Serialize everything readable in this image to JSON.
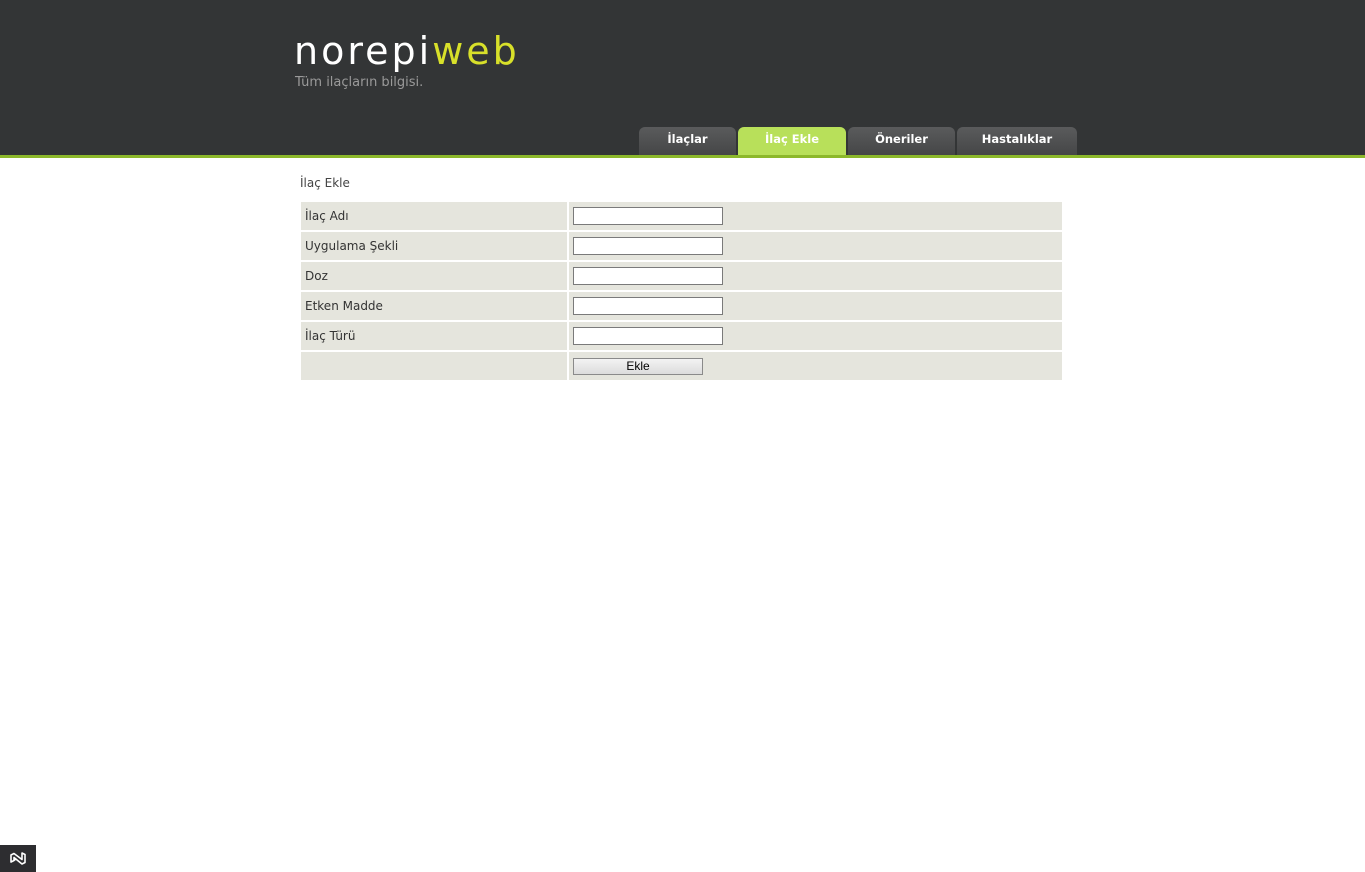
{
  "header": {
    "logo_part1": "norepi",
    "logo_part2": "web",
    "tagline": "Tüm ilaçların bilgisi."
  },
  "nav": {
    "tabs": [
      {
        "label": "İlaçlar",
        "active": false
      },
      {
        "label": "İlaç Ekle",
        "active": true
      },
      {
        "label": "Öneriler",
        "active": false
      },
      {
        "label": "Hastalıklar",
        "active": false
      }
    ]
  },
  "main": {
    "title": "İlaç Ekle",
    "fields": [
      {
        "label": "İlaç Adı",
        "value": ""
      },
      {
        "label": "Uygulama Şekli",
        "value": ""
      },
      {
        "label": "Doz",
        "value": ""
      },
      {
        "label": "Etken Madde",
        "value": ""
      },
      {
        "label": "İlaç Türü",
        "value": ""
      }
    ],
    "submit_label": "Ekle"
  },
  "colors": {
    "header_bg": "#333536",
    "accent_green": "#8cb82b",
    "active_tab": "#b8e05a",
    "logo_yellow": "#d8e02a"
  },
  "icons": {
    "bottom_left": "visual-studio-icon"
  }
}
